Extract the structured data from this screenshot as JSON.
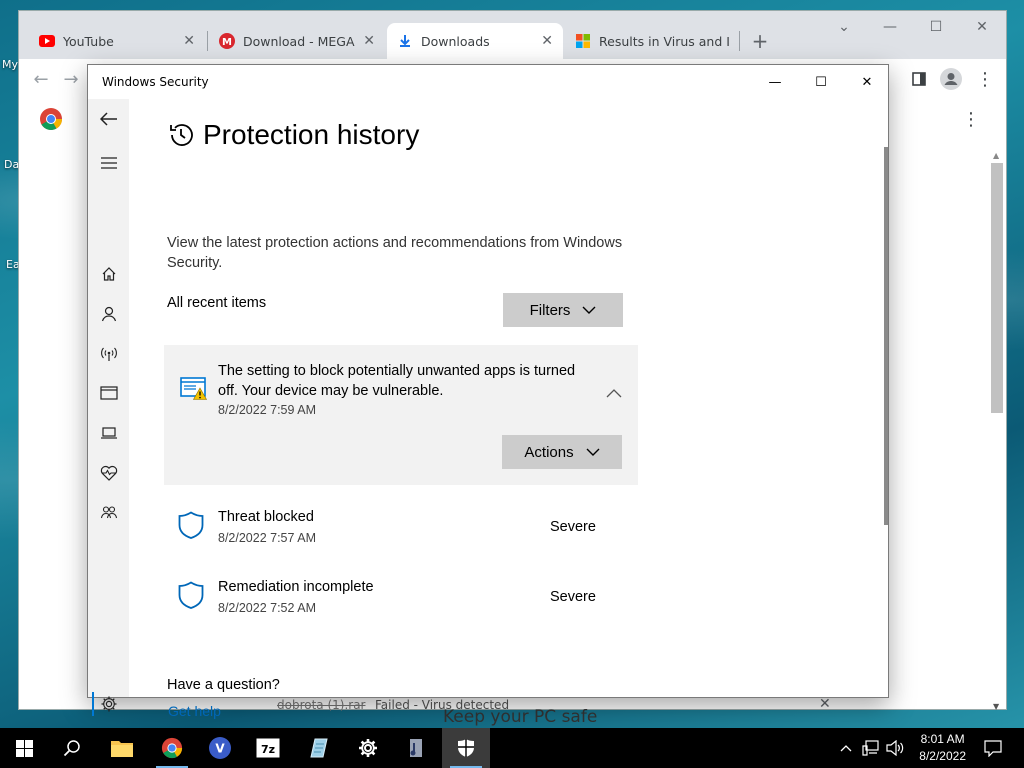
{
  "desktop": {
    "labels": [
      "My",
      "Da",
      "Ea"
    ]
  },
  "browser": {
    "tabs": [
      {
        "title": "YouTube",
        "icon": "youtube-icon"
      },
      {
        "title": "Download - MEGA",
        "icon": "mega-icon"
      },
      {
        "title": "Downloads",
        "icon": "download-icon",
        "active": true
      },
      {
        "title": "Results in Virus and I",
        "icon": "microsoft-icon"
      }
    ],
    "new_tab": "+",
    "download_item": {
      "filename": "dobrota (1).rar",
      "status": "Failed - Virus detected"
    },
    "behind_text": "Keep your PC safe"
  },
  "window": {
    "title": "Windows Security",
    "controls": {
      "minimize": "—",
      "maximize": "☐",
      "close": "✕"
    }
  },
  "page": {
    "title": "Protection history",
    "description": "View the latest protection actions and recommendations from Windows Security.",
    "section_label": "All recent items",
    "filters_button": "Filters",
    "expanded_item": {
      "message": "The setting to block potentially unwanted apps is turned off. Your device may be vulnerable.",
      "timestamp": "8/2/2022 7:59 AM",
      "actions_button": "Actions"
    },
    "items": [
      {
        "name": "Threat blocked",
        "timestamp": "8/2/2022 7:57 AM",
        "severity": "Severe"
      },
      {
        "name": "Remediation incomplete",
        "timestamp": "8/2/2022 7:52 AM",
        "severity": "Severe"
      }
    ],
    "question": "Have a question?",
    "help_link": "Get help"
  },
  "nav": {
    "items": [
      "back",
      "menu",
      "home",
      "account",
      "network",
      "app-browser",
      "device-security",
      "device-health",
      "family"
    ],
    "settings": "settings"
  },
  "taskbar": {
    "time": "8:01 AM",
    "date": "8/2/2022",
    "apps": [
      "start",
      "search",
      "file-explorer",
      "chrome",
      "vpn",
      "7zip",
      "app",
      "settings",
      "media",
      "windows-security"
    ]
  },
  "colors": {
    "accent": "#0078d4",
    "link": "#0067b8",
    "warning": "#f2c200"
  }
}
